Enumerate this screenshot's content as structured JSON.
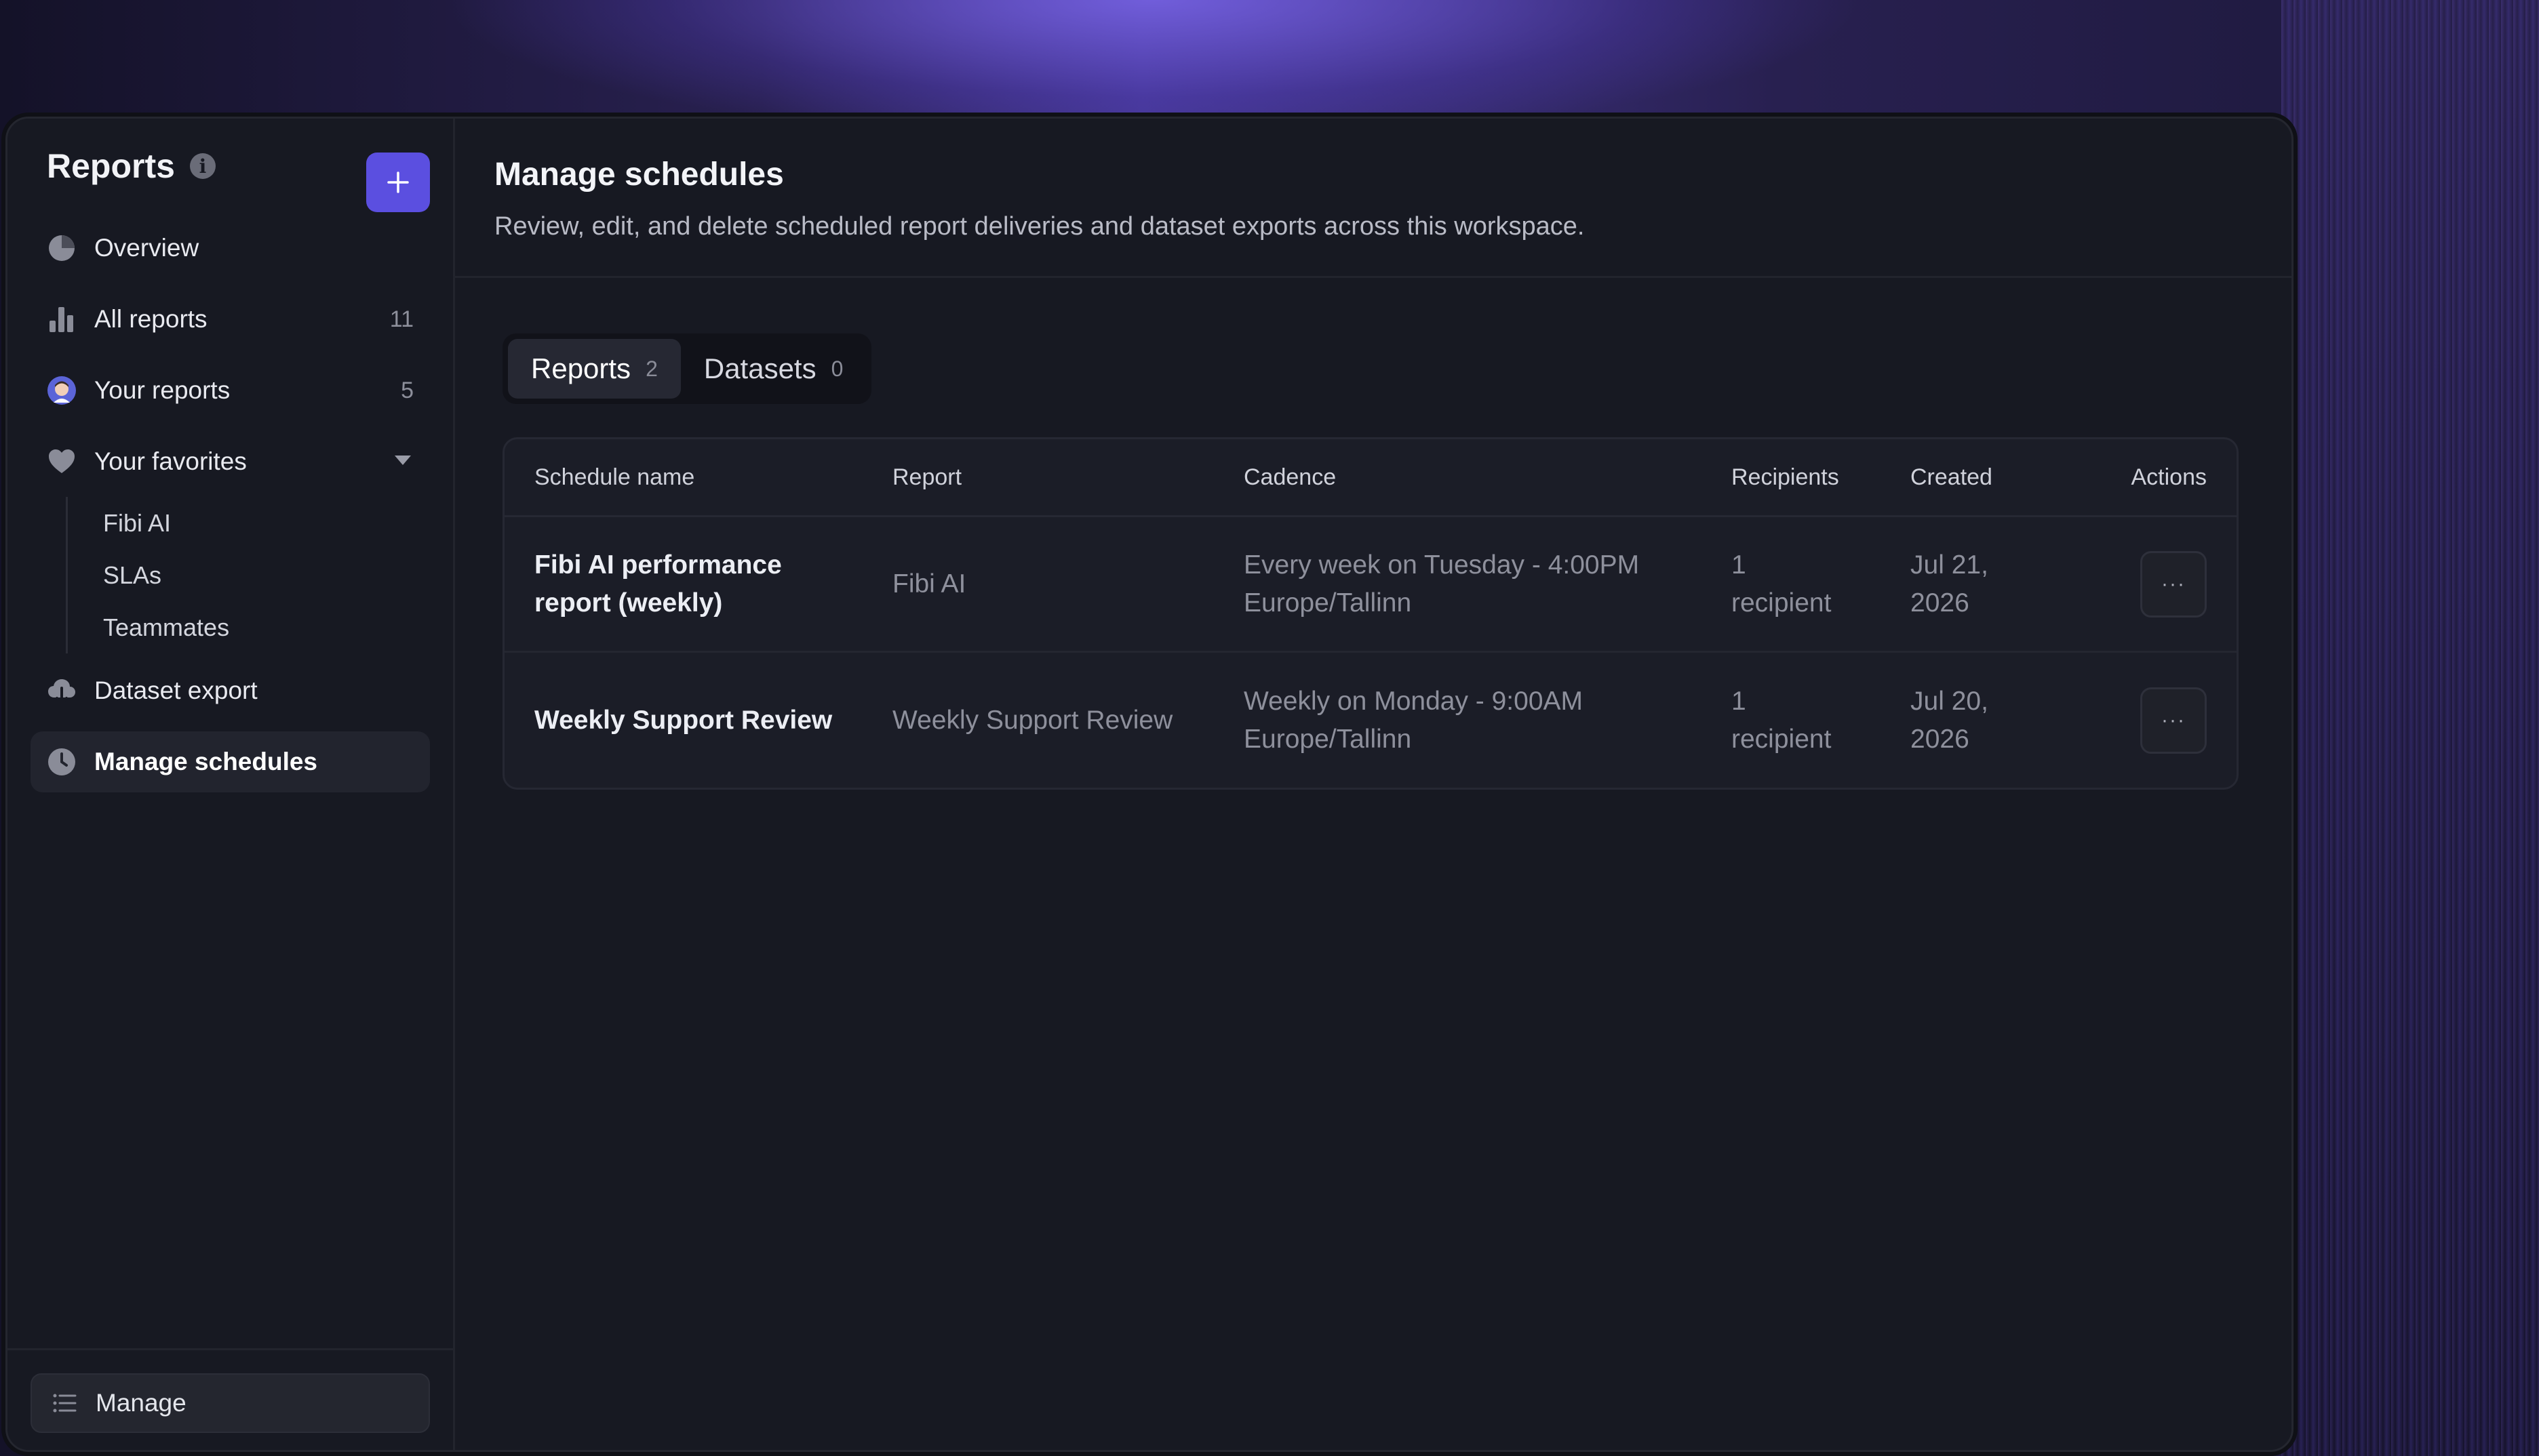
{
  "sidebar": {
    "title": "Reports",
    "nav": [
      {
        "label": "Overview",
        "icon": "pie-chart-icon",
        "count": ""
      },
      {
        "label": "All reports",
        "icon": "bar-chart-icon",
        "count": "11"
      },
      {
        "label": "Your reports",
        "icon": "avatar-icon",
        "count": "5"
      },
      {
        "label": "Your favorites",
        "icon": "heart-icon",
        "count": ""
      }
    ],
    "favorites": [
      "Fibi AI",
      "SLAs",
      "Teammates"
    ],
    "nav2": [
      {
        "label": "Dataset export",
        "icon": "cloud-download-icon"
      },
      {
        "label": "Manage schedules",
        "icon": "clock-icon"
      }
    ],
    "footer_label": "Manage"
  },
  "main": {
    "title": "Manage schedules",
    "description": "Review, edit, and delete scheduled report deliveries and dataset exports across this workspace.",
    "tabs": [
      {
        "label": "Reports",
        "count": "2"
      },
      {
        "label": "Datasets",
        "count": "0"
      }
    ],
    "table": {
      "headers": [
        "Schedule name",
        "Report",
        "Cadence",
        "Recipients",
        "Created",
        "Actions"
      ],
      "rows": [
        {
          "name_line1": "Fibi AI performance",
          "name_line2": "report (weekly)",
          "report": "Fibi AI",
          "cadence_line1": "Every week on Tuesday - 4:00PM",
          "cadence_line2": "Europe/Tallinn",
          "recipients_line1": "1",
          "recipients_line2": "recipient",
          "created_line1": "Jul 21,",
          "created_line2": "2026",
          "action": "···"
        },
        {
          "name_line1": "Weekly Support Review",
          "name_line2": "",
          "report": "Weekly Support Review",
          "cadence_line1": "Weekly on Monday - 9:00AM",
          "cadence_line2": "Europe/Tallinn",
          "recipients_line1": "1",
          "recipients_line2": "recipient",
          "created_line1": "Jul 20,",
          "created_line2": "2026",
          "action": "···"
        }
      ]
    }
  },
  "colors": {
    "accent": "#5b4fe0",
    "background": "#171922"
  }
}
